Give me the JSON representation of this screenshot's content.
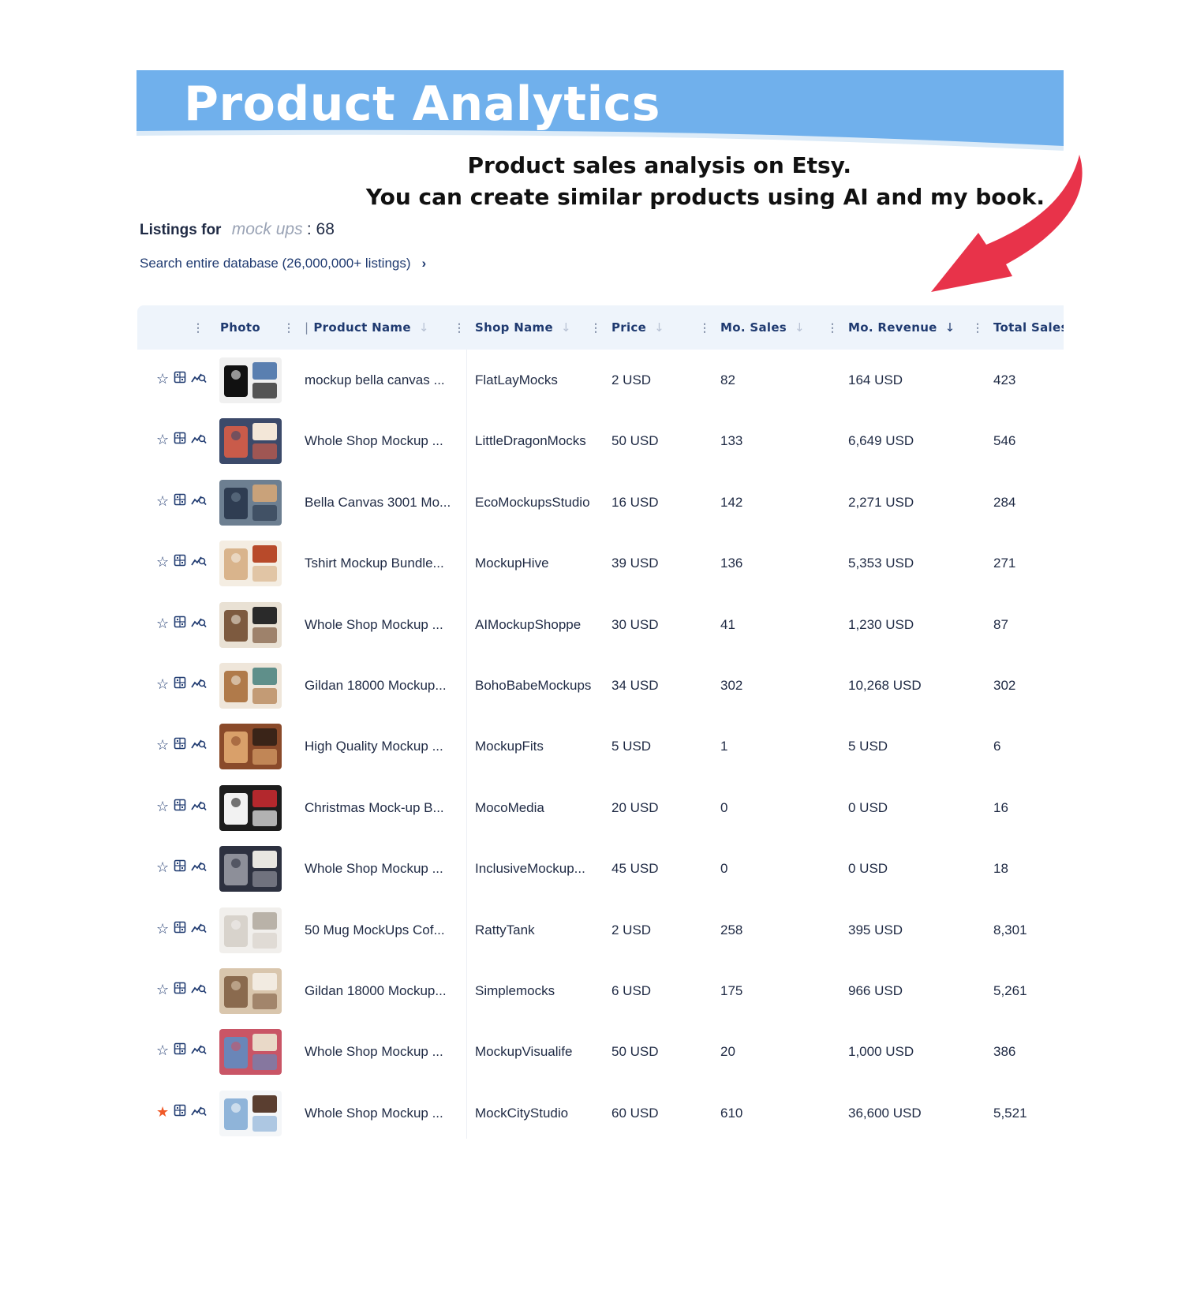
{
  "banner": {
    "title": "Product Analytics",
    "color": "#70b0ec"
  },
  "caption": {
    "line1": "Product sales analysis on Etsy.",
    "line2": "You can create similar products using AI and my book."
  },
  "arrow_color": "#e8334a",
  "listings": {
    "label": "Listings for",
    "keyword": "mock ups",
    "count": ": 68"
  },
  "search_database": {
    "label": "Search entire database (26,000,000+ listings)",
    "chevron": "›"
  },
  "table": {
    "columns": [
      {
        "key": "photo",
        "label": "Photo"
      },
      {
        "key": "product_name",
        "label": "Product Name"
      },
      {
        "key": "shop_name",
        "label": "Shop Name"
      },
      {
        "key": "price",
        "label": "Price"
      },
      {
        "key": "mo_sales",
        "label": "Mo. Sales"
      },
      {
        "key": "mo_revenue",
        "label": "Mo. Revenue"
      },
      {
        "key": "total_sales",
        "label": "Total Sales"
      }
    ],
    "active_sort": "mo_revenue",
    "row_icons": [
      "star-icon",
      "listing-details-icon",
      "trend-chart-icon"
    ],
    "rows": [
      {
        "product": "mockup bella canvas ...",
        "shop": "FlatLayMocks",
        "price": "2 USD",
        "mo_sales": "82",
        "mo_revenue": "164 USD",
        "total_sales": "423",
        "favorite": false,
        "thumb_colors": [
          "#f0f0f0",
          "#111111",
          "#5a7fb0"
        ]
      },
      {
        "product": "Whole Shop Mockup ...",
        "shop": "LittleDragonMocks",
        "price": "50 USD",
        "mo_sales": "133",
        "mo_revenue": "6,649 USD",
        "total_sales": "546",
        "favorite": false,
        "thumb_colors": [
          "#3c4a6a",
          "#c95b4a",
          "#f3e7d8"
        ]
      },
      {
        "product": "Bella Canvas 3001 Mo...",
        "shop": "EcoMockupsStudio",
        "price": "16 USD",
        "mo_sales": "142",
        "mo_revenue": "2,271 USD",
        "total_sales": "284",
        "favorite": false,
        "thumb_colors": [
          "#6d7f91",
          "#2f3d52",
          "#c9a27a"
        ]
      },
      {
        "product": "Tshirt Mockup Bundle...",
        "shop": "MockupHive",
        "price": "39 USD",
        "mo_sales": "136",
        "mo_revenue": "5,353 USD",
        "total_sales": "271",
        "favorite": false,
        "thumb_colors": [
          "#f4ede2",
          "#d9b48c",
          "#b84a2a"
        ]
      },
      {
        "product": "Whole Shop Mockup ...",
        "shop": "AIMockupShoppe",
        "price": "30 USD",
        "mo_sales": "41",
        "mo_revenue": "1,230 USD",
        "total_sales": "87",
        "favorite": false,
        "thumb_colors": [
          "#e9e1d4",
          "#7d5a3f",
          "#2a2a2a"
        ]
      },
      {
        "product": "Gildan 18000 Mockup...",
        "shop": "BohoBabeMockups",
        "price": "34 USD",
        "mo_sales": "302",
        "mo_revenue": "10,268 USD",
        "total_sales": "302",
        "favorite": false,
        "thumb_colors": [
          "#efe6da",
          "#b07a4a",
          "#5f8f8a"
        ]
      },
      {
        "product": "High Quality Mockup ...",
        "shop": "MockupFits",
        "price": "5 USD",
        "mo_sales": "1",
        "mo_revenue": "5 USD",
        "total_sales": "6",
        "favorite": false,
        "thumb_colors": [
          "#8a4a2a",
          "#d9a06a",
          "#3a2418"
        ]
      },
      {
        "product": "Christmas Mock-up B...",
        "shop": "MocoMedia",
        "price": "20 USD",
        "mo_sales": "0",
        "mo_revenue": "0 USD",
        "total_sales": "16",
        "favorite": false,
        "thumb_colors": [
          "#1d1d1d",
          "#f2f2f2",
          "#b3282d"
        ]
      },
      {
        "product": "Whole Shop Mockup ...",
        "shop": "InclusiveMockup...",
        "price": "45 USD",
        "mo_sales": "0",
        "mo_revenue": "0 USD",
        "total_sales": "18",
        "favorite": false,
        "thumb_colors": [
          "#2d3140",
          "#8d8f99",
          "#e8e6e1"
        ]
      },
      {
        "product": "50 Mug MockUps Cof...",
        "shop": "RattyTank",
        "price": "2 USD",
        "mo_sales": "258",
        "mo_revenue": "395 USD",
        "total_sales": "8,301",
        "favorite": false,
        "thumb_colors": [
          "#f1efec",
          "#d8d3cc",
          "#b9b2a8"
        ]
      },
      {
        "product": "Gildan 18000 Mockup...",
        "shop": "Simplemocks",
        "price": "6 USD",
        "mo_sales": "175",
        "mo_revenue": "966 USD",
        "total_sales": "5,261",
        "favorite": false,
        "thumb_colors": [
          "#d9c6ad",
          "#8a6a4e",
          "#f2ebe1"
        ]
      },
      {
        "product": "Whole Shop Mockup ...",
        "shop": "MockupVisualife",
        "price": "50 USD",
        "mo_sales": "20",
        "mo_revenue": "1,000 USD",
        "total_sales": "386",
        "favorite": false,
        "thumb_colors": [
          "#c95566",
          "#6a86b8",
          "#e9d9c8"
        ]
      },
      {
        "product": "Whole Shop Mockup ...",
        "shop": "MockCityStudio",
        "price": "60 USD",
        "mo_sales": "610",
        "mo_revenue": "36,600 USD",
        "total_sales": "5,521",
        "favorite": true,
        "thumb_colors": [
          "#f4f6f8",
          "#8fb4d9",
          "#5a3e30"
        ]
      }
    ]
  }
}
